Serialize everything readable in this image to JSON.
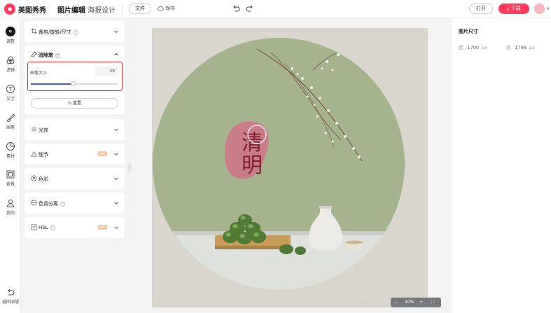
{
  "header": {
    "brand": "美图秀秀",
    "tabs": [
      {
        "label": "图片编辑",
        "active": true
      },
      {
        "label": "海报设计",
        "active": false
      }
    ],
    "file_label": "文件",
    "save_label": "保存",
    "open_label": "打开",
    "download_label": "下载"
  },
  "rail": {
    "items": [
      {
        "label": "调整",
        "icon": "adjust-icon",
        "active": true
      },
      {
        "label": "滤镜",
        "icon": "filter-icon"
      },
      {
        "label": "文字",
        "icon": "text-icon"
      },
      {
        "label": "画笔",
        "icon": "brush-icon"
      },
      {
        "label": "素材",
        "icon": "sticker-icon"
      },
      {
        "label": "背景",
        "icon": "background-icon"
      },
      {
        "label": "我的",
        "icon": "user-icon"
      }
    ],
    "back_label": "返回旧版"
  },
  "panel": {
    "crop_label": "裁剪/旋转/尺寸",
    "eraser": {
      "title": "消除笔",
      "size_label": "画笔大小",
      "size_value": "49",
      "slider_fraction": 0.49,
      "reset_label": "重置"
    },
    "sections": [
      {
        "label": "光效",
        "vip": false,
        "help": false
      },
      {
        "label": "细节",
        "vip": true,
        "help": false
      },
      {
        "label": "色彩",
        "vip": false,
        "help": false
      },
      {
        "label": "色调分离",
        "vip": false,
        "help": true
      },
      {
        "label": "HSL",
        "vip": true,
        "help": true
      }
    ],
    "vip_badge": "VIP"
  },
  "canvas": {
    "poster_char_1": "清",
    "poster_char_2": "明",
    "zoom_label": "40%",
    "zoom_minus": "−",
    "zoom_plus": "+"
  },
  "right_panel": {
    "title": "图片尺寸",
    "width_label": "宽",
    "width_value": "1790",
    "height_label": "高",
    "height_value": "1798",
    "unit": "px"
  },
  "colors": {
    "accent": "#ff3a5c",
    "highlight": "#e53333",
    "slider": "#3a5bd9",
    "poster_green": "#a4b38b"
  }
}
